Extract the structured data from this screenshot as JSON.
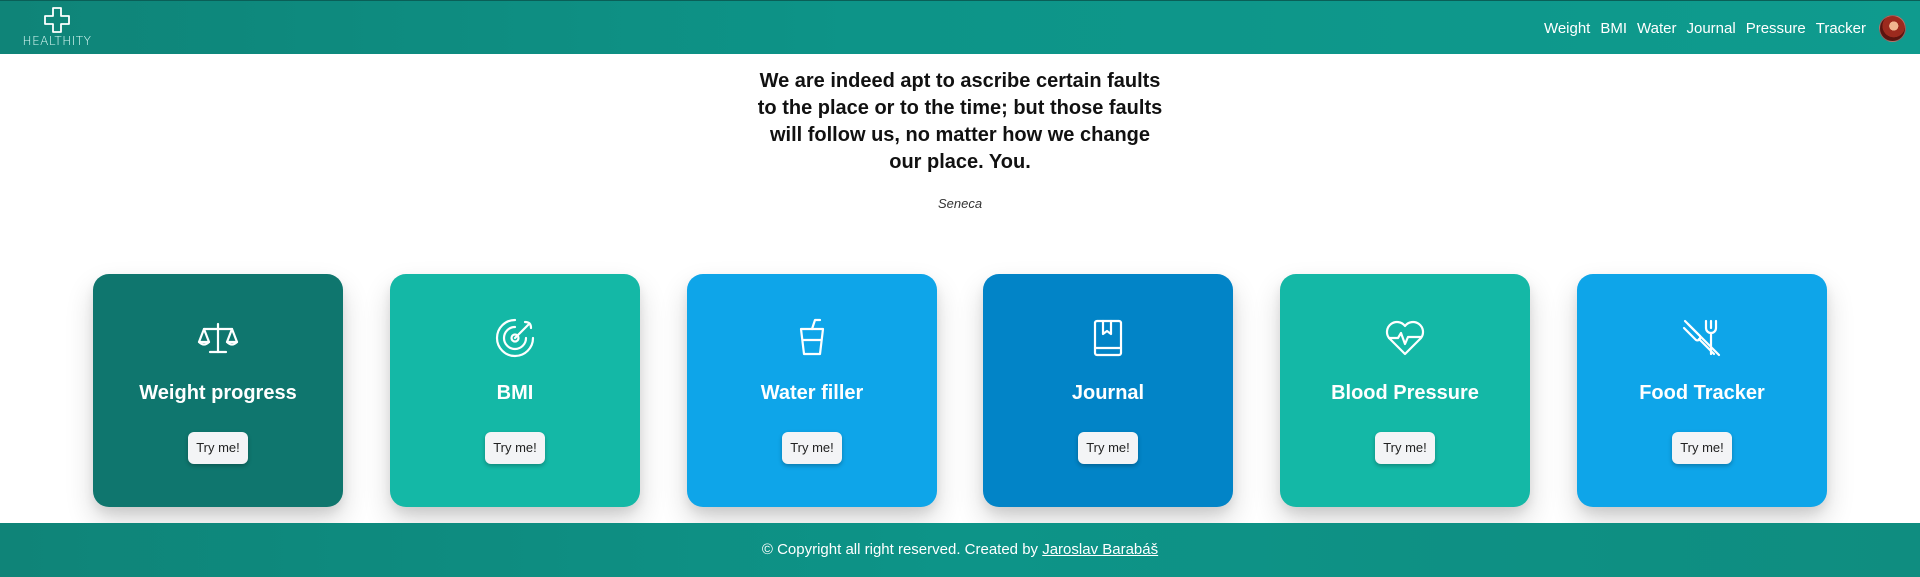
{
  "header": {
    "logo_text": "HEALTHITY",
    "nav": [
      "Weight",
      "BMI",
      "Water",
      "Journal",
      "Pressure",
      "Tracker"
    ]
  },
  "quote": {
    "text": "We are indeed apt to ascribe certain faults to the place or to the time; but those faults will follow us, no matter how we change our place. You.",
    "author": "Seneca"
  },
  "cards": [
    {
      "title": "Weight progress",
      "button": "Try me!",
      "icon": "scale-icon",
      "color": "#0f766e"
    },
    {
      "title": "BMI",
      "button": "Try me!",
      "icon": "radar-icon",
      "color": "#14b8a6"
    },
    {
      "title": "Water filler",
      "button": "Try me!",
      "icon": "cup-icon",
      "color": "#0ea5e9"
    },
    {
      "title": "Journal",
      "button": "Try me!",
      "icon": "book-icon",
      "color": "#0284c7"
    },
    {
      "title": "Blood Pressure",
      "button": "Try me!",
      "icon": "heart-pulse-icon",
      "color": "#14b8a6"
    },
    {
      "title": "Food Tracker",
      "button": "Try me!",
      "icon": "utensils-off-icon",
      "color": "#0ea5e9"
    }
  ],
  "footer": {
    "text": "© Copyright all right reserved. Created by",
    "author_link": "Jaroslav Barabáš"
  }
}
